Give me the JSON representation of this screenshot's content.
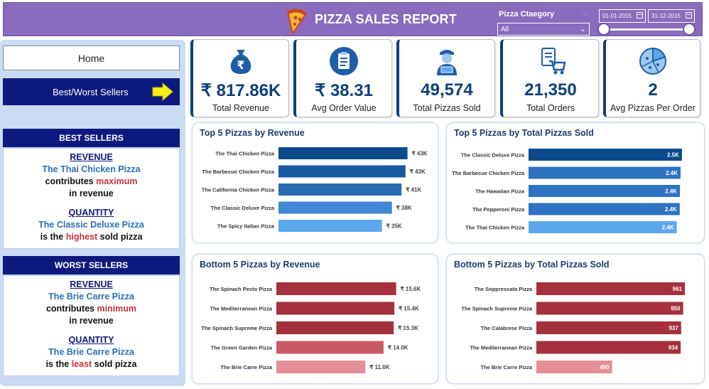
{
  "header": {
    "title": "PIZZA SALES REPORT",
    "filter_label": "Pizza Ctaegory",
    "filter_value": "All",
    "date_from": "01-01-2015",
    "date_to": "31-12-2015"
  },
  "sidebar": {
    "home_label": "Home",
    "best_worst_label": "Best/Worst Sellers",
    "best": {
      "heading": "BEST SELLERS",
      "revenue_title": "REVENUE",
      "revenue_pizza": "The Thai Chicken Pizza",
      "revenue_line1_a": "contributes",
      "revenue_line1_b": "maximum",
      "revenue_line2": "in revenue",
      "quantity_title": "QUANTITY",
      "quantity_pizza": "The Classic Deluxe Pizza",
      "quantity_line_a": "is the",
      "quantity_line_b": "highest",
      "quantity_line_c": "sold pizza"
    },
    "worst": {
      "heading": "WORST SELLERS",
      "revenue_title": "REVENUE",
      "revenue_pizza": "The Brie Carre Pizza",
      "revenue_line1_a": "contributes",
      "revenue_line1_b": "minimum",
      "revenue_line2": "in revenue",
      "quantity_title": "QUANTITY",
      "quantity_pizza": "The Brie Carre Pizza",
      "quantity_line_a": "is the",
      "quantity_line_b": "least",
      "quantity_line_c": "sold pizza"
    }
  },
  "kpis": [
    {
      "value": "₹ 817.86K",
      "label": "Total Revenue",
      "icon": "rupee-bag-icon"
    },
    {
      "value": "₹ 38.31",
      "label": "Avg Order Value",
      "icon": "clipboard-icon"
    },
    {
      "value": "49,574",
      "label": "Total Pizzas Sold",
      "icon": "delivery-person-icon"
    },
    {
      "value": "21,350",
      "label": "Total Orders",
      "icon": "shopping-cart-icon"
    },
    {
      "value": "2",
      "label": "Avg Pizzas Per Order",
      "icon": "pizza-slice-icon"
    }
  ],
  "colors": {
    "header_bg": "#8a6bbd",
    "nav_dark": "#0d1a7d",
    "blue_dark": "#0d4a8c",
    "blue_mid": "#2e72c2",
    "blue_light": "#5ba7ee",
    "red_dark": "#a6303d",
    "red_light": "#e48e96"
  },
  "chart_data": [
    {
      "type": "bar",
      "title": "Top 5 Pizzas by Revenue",
      "categories": [
        "The Thai Chicken Pizza",
        "The Barbecue Chicken Pizza",
        "The California Chicken Pizza",
        "The Classic Deluxe Pizza",
        "The Spicy Italian Pizza"
      ],
      "values": [
        43434,
        42768,
        41410,
        38181,
        34831
      ],
      "labels": [
        "₹ 43K",
        "₹ 43K",
        "₹ 41K",
        "₹ 38K",
        "₹ 35K"
      ],
      "xlim": [
        0,
        55000
      ],
      "bar_colors": [
        "#0d4a8c",
        "#175aa0",
        "#2a6bb5",
        "#3f86d4",
        "#5ba7ee"
      ],
      "label_position": "outside"
    },
    {
      "type": "bar",
      "title": "Top 5 Pizzas by Total Pizzas Sold",
      "categories": [
        "The Classic Deluxe Pizza",
        "The Barbecue Chicken Pizza",
        "The Hawaiian Pizza",
        "The Pepperoni Pizza",
        "The Thai Chicken Pizza"
      ],
      "values": [
        2453,
        2432,
        2422,
        2418,
        2371
      ],
      "labels": [
        "2.5K",
        "2.4K",
        "2.4K",
        "2.4K",
        "2.4K"
      ],
      "xlim": [
        0,
        2500
      ],
      "bar_colors": [
        "#0d4a8c",
        "#2e72c2",
        "#2e72c2",
        "#2e72c2",
        "#5ba7ee"
      ],
      "label_position": "inside"
    },
    {
      "type": "bar",
      "title": "Bottom 5 Pizzas by Revenue",
      "categories": [
        "The Spinach Pesto Pizza",
        "The Mediterranean Pizza",
        "The Spinach Supreme Pizza",
        "The Green Garden Pizza",
        "The Brie Carre Pizza"
      ],
      "values": [
        15596,
        15360,
        15277,
        13956,
        11588
      ],
      "labels": [
        "₹ 15.6K",
        "₹ 15.4K",
        "₹ 15.3K",
        "₹ 14.0K",
        "₹ 11.6K"
      ],
      "xlim": [
        0,
        18500
      ],
      "bar_colors": [
        "#a6303d",
        "#a6303d",
        "#a6303d",
        "#c85a66",
        "#e48e96"
      ],
      "label_position": "outside"
    },
    {
      "type": "bar",
      "title": "Bottom 5 Pizzas by Total Pizzas Sold",
      "categories": [
        "The Soppressata Pizza",
        "The Spinach Supreme Pizza",
        "The Calabrese Pizza",
        "The Mediterranean Pizza",
        "The Brie Carre Pizza"
      ],
      "values": [
        961,
        950,
        937,
        934,
        490
      ],
      "labels": [
        "961",
        "950",
        "937",
        "934",
        "490"
      ],
      "xlim": [
        0,
        961
      ],
      "bar_colors": [
        "#a6303d",
        "#a6303d",
        "#a6303d",
        "#a6303d",
        "#e48e96"
      ],
      "label_position": "inside"
    }
  ]
}
